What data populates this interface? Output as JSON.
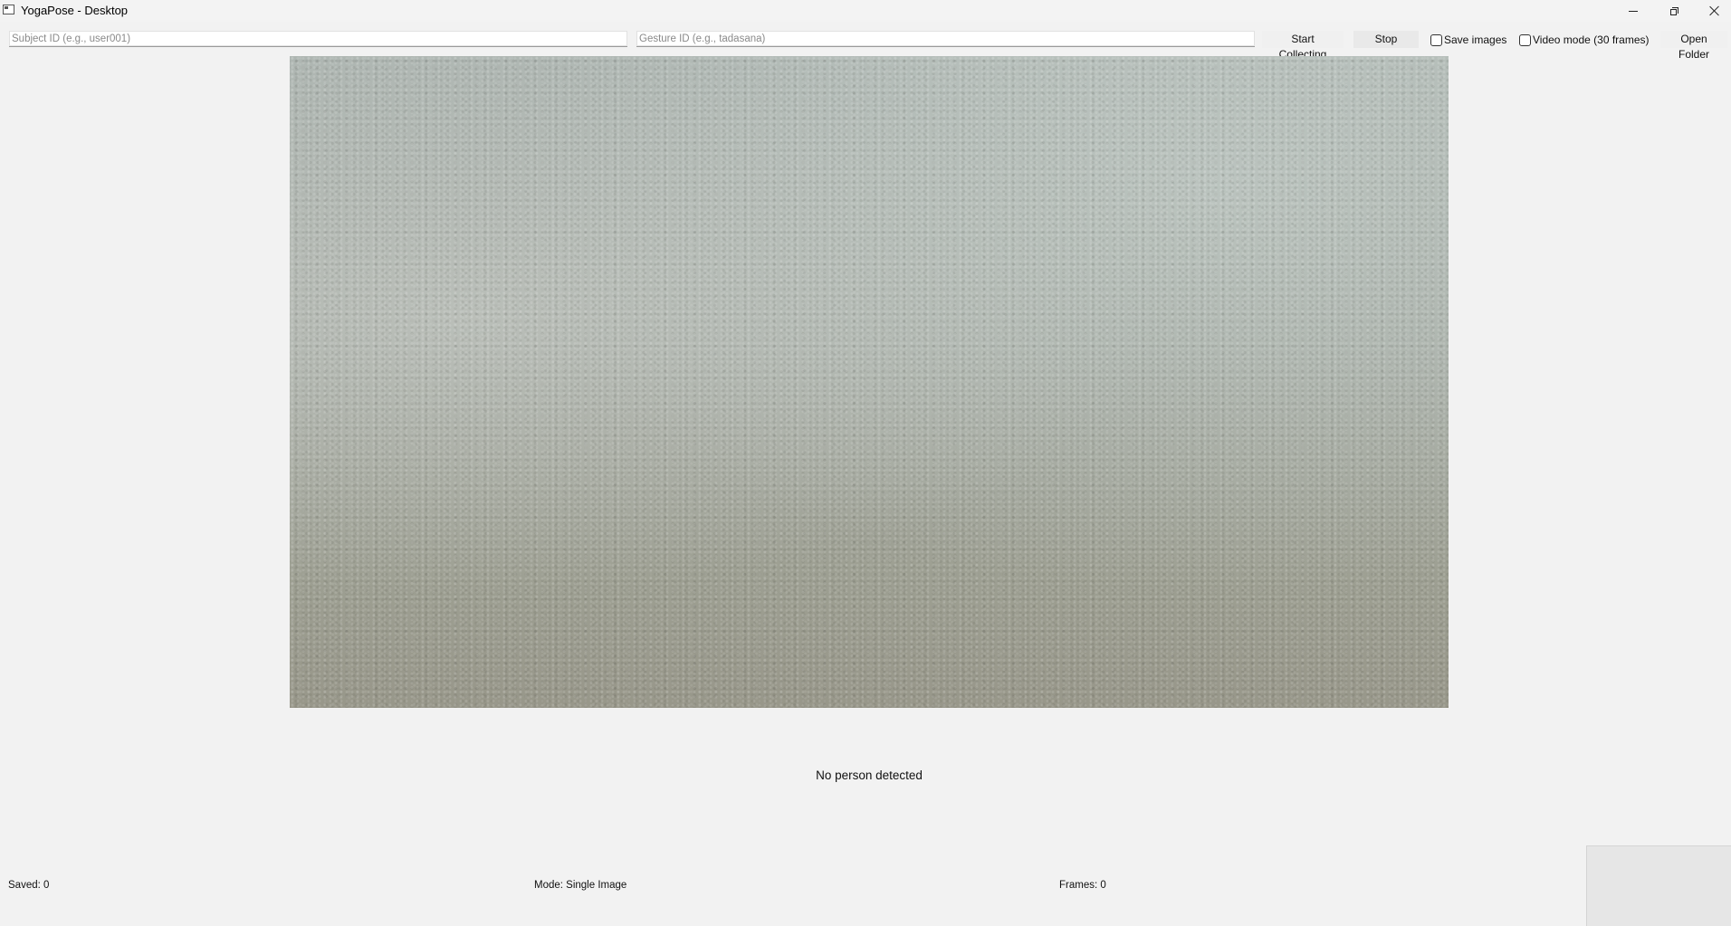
{
  "window": {
    "title": "YogaPose - Desktop"
  },
  "toolbar": {
    "subject_placeholder": "Subject ID (e.g., user001)",
    "subject_value": "",
    "gesture_placeholder": "Gesture ID (e.g., tadasana)",
    "gesture_value": "",
    "start_label": "Start Collecting",
    "stop_label": "Stop",
    "save_images_label": "Save images",
    "save_images_checked": false,
    "video_mode_label": "Video mode (30 frames)",
    "video_mode_checked": false,
    "open_folder_label": "Open Folder"
  },
  "main": {
    "detection_status": "No person detected"
  },
  "status_bar": {
    "saved": "Saved: 0",
    "mode": "Mode: Single Image",
    "frames": "Frames: 0"
  },
  "icons": [
    "app-icon",
    "minimize-icon",
    "maximize-icon",
    "close-icon"
  ]
}
